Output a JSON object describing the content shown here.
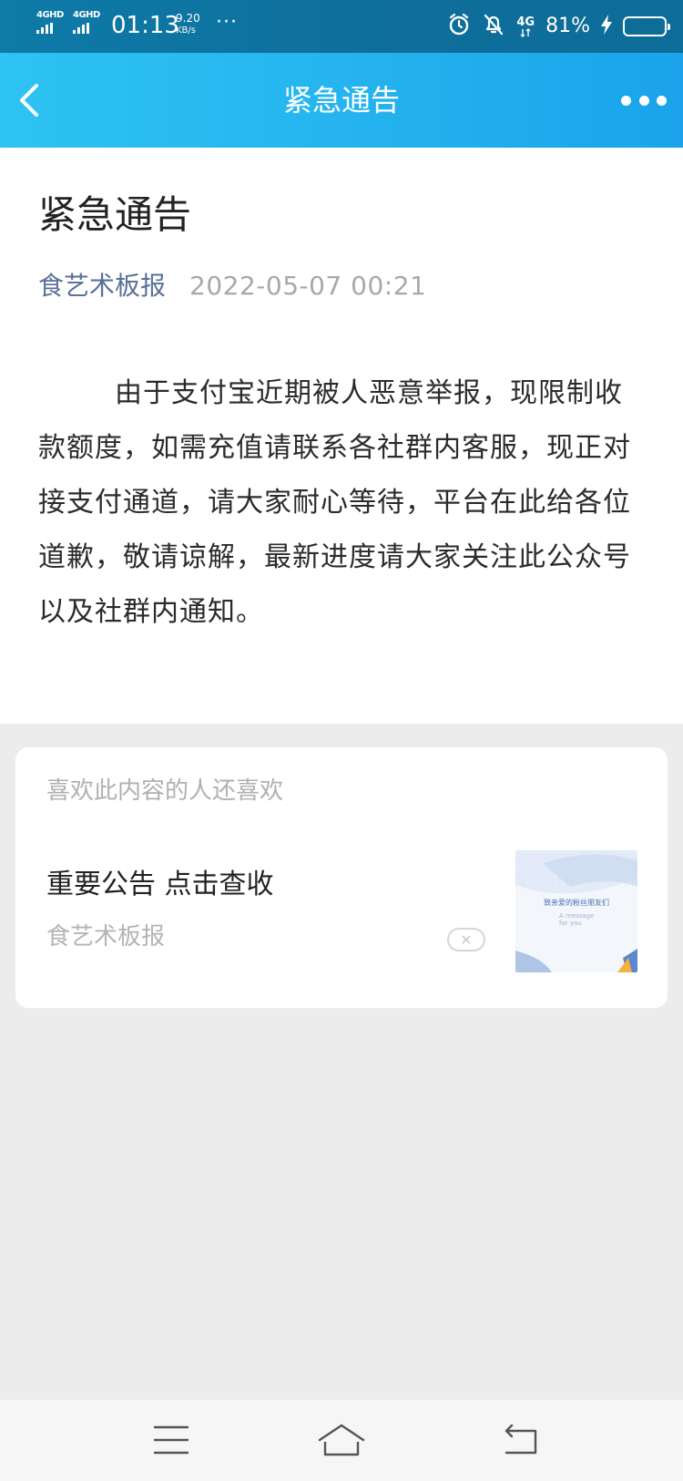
{
  "status_bar": {
    "signal1_label": "4GHD",
    "signal2_label": "4GHD",
    "time": "01:13",
    "speed_value": "9.20",
    "speed_unit": "KB/s",
    "more_dots": "···",
    "network_label": "4G",
    "battery_percent": "81%",
    "battery_level": 0.81
  },
  "nav": {
    "title": "紧急通告",
    "back_icon": "chevron-left-icon",
    "more_icon": "more-dots-icon"
  },
  "article": {
    "title": "紧急通告",
    "author": "食艺术板报",
    "date": "2022-05-07 00:21",
    "body": "由于支付宝近期被人恶意举报，现限制收款额度，如需充值请联系各社群内客服，现正对接支付通道，请大家耐心等待，平台在此给各位道歉，敬请谅解，最新进度请大家关注此公众号以及社群内通知。"
  },
  "recommendations": {
    "heading": "喜欢此内容的人还喜欢",
    "items": [
      {
        "title": "重要公告 点击查收",
        "source": "食艺术板报",
        "dismiss_glyph": "×",
        "thumb_caption": "致亲爱的粉丝朋友们",
        "thumb_subcaption": "A message for you"
      }
    ]
  },
  "system_nav": {
    "menu_icon": "menu-icon",
    "home_icon": "home-icon",
    "back_icon": "back-arrow-icon"
  },
  "colors": {
    "status_bar": "#0f6e9b",
    "nav_bar": "#25b4ef",
    "author_link": "#5a7097",
    "page_background": "#ececec"
  }
}
